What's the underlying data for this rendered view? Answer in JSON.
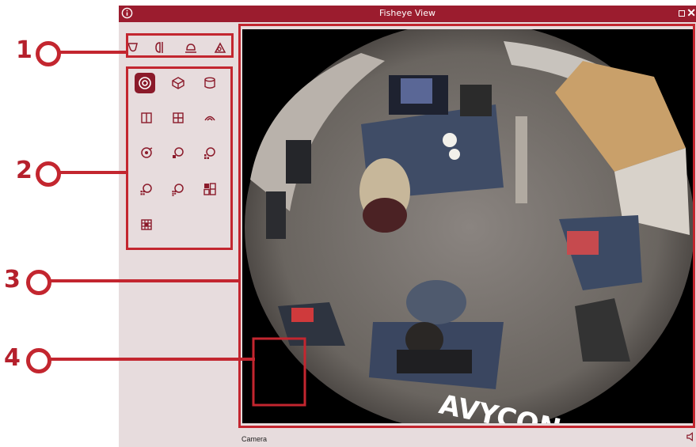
{
  "window": {
    "title": "Fisheye View"
  },
  "status": {
    "source_label": "Camera"
  },
  "callouts": [
    "1",
    "2",
    "3",
    "4"
  ],
  "colors": {
    "accent": "#9b1c2e",
    "callout": "#c3262f",
    "panel": "#e7dcdd"
  },
  "mount_modes": [
    {
      "icon": "wall-mount-icon"
    },
    {
      "icon": "ceiling-mount-icon"
    },
    {
      "icon": "ground-mount-icon"
    },
    {
      "icon": "tilt-mount-icon"
    }
  ],
  "view_layouts": [
    {
      "icon": "fisheye-original-icon",
      "active": true
    },
    {
      "icon": "3d-cube-icon"
    },
    {
      "icon": "cylinder-icon"
    },
    {
      "icon": "dual-panorama-icon"
    },
    {
      "icon": "quad-view-icon"
    },
    {
      "icon": "panorama-180-icon"
    },
    {
      "icon": "fisheye-ptz-icon"
    },
    {
      "icon": "fisheye-ptz-2-icon"
    },
    {
      "icon": "fisheye-ptz-3-icon"
    },
    {
      "icon": "fisheye-ptz-4-icon"
    },
    {
      "icon": "fisheye-ptz-6-icon"
    },
    {
      "icon": "fisheye-quad-combo-icon"
    },
    {
      "icon": "grid-9-icon"
    }
  ]
}
